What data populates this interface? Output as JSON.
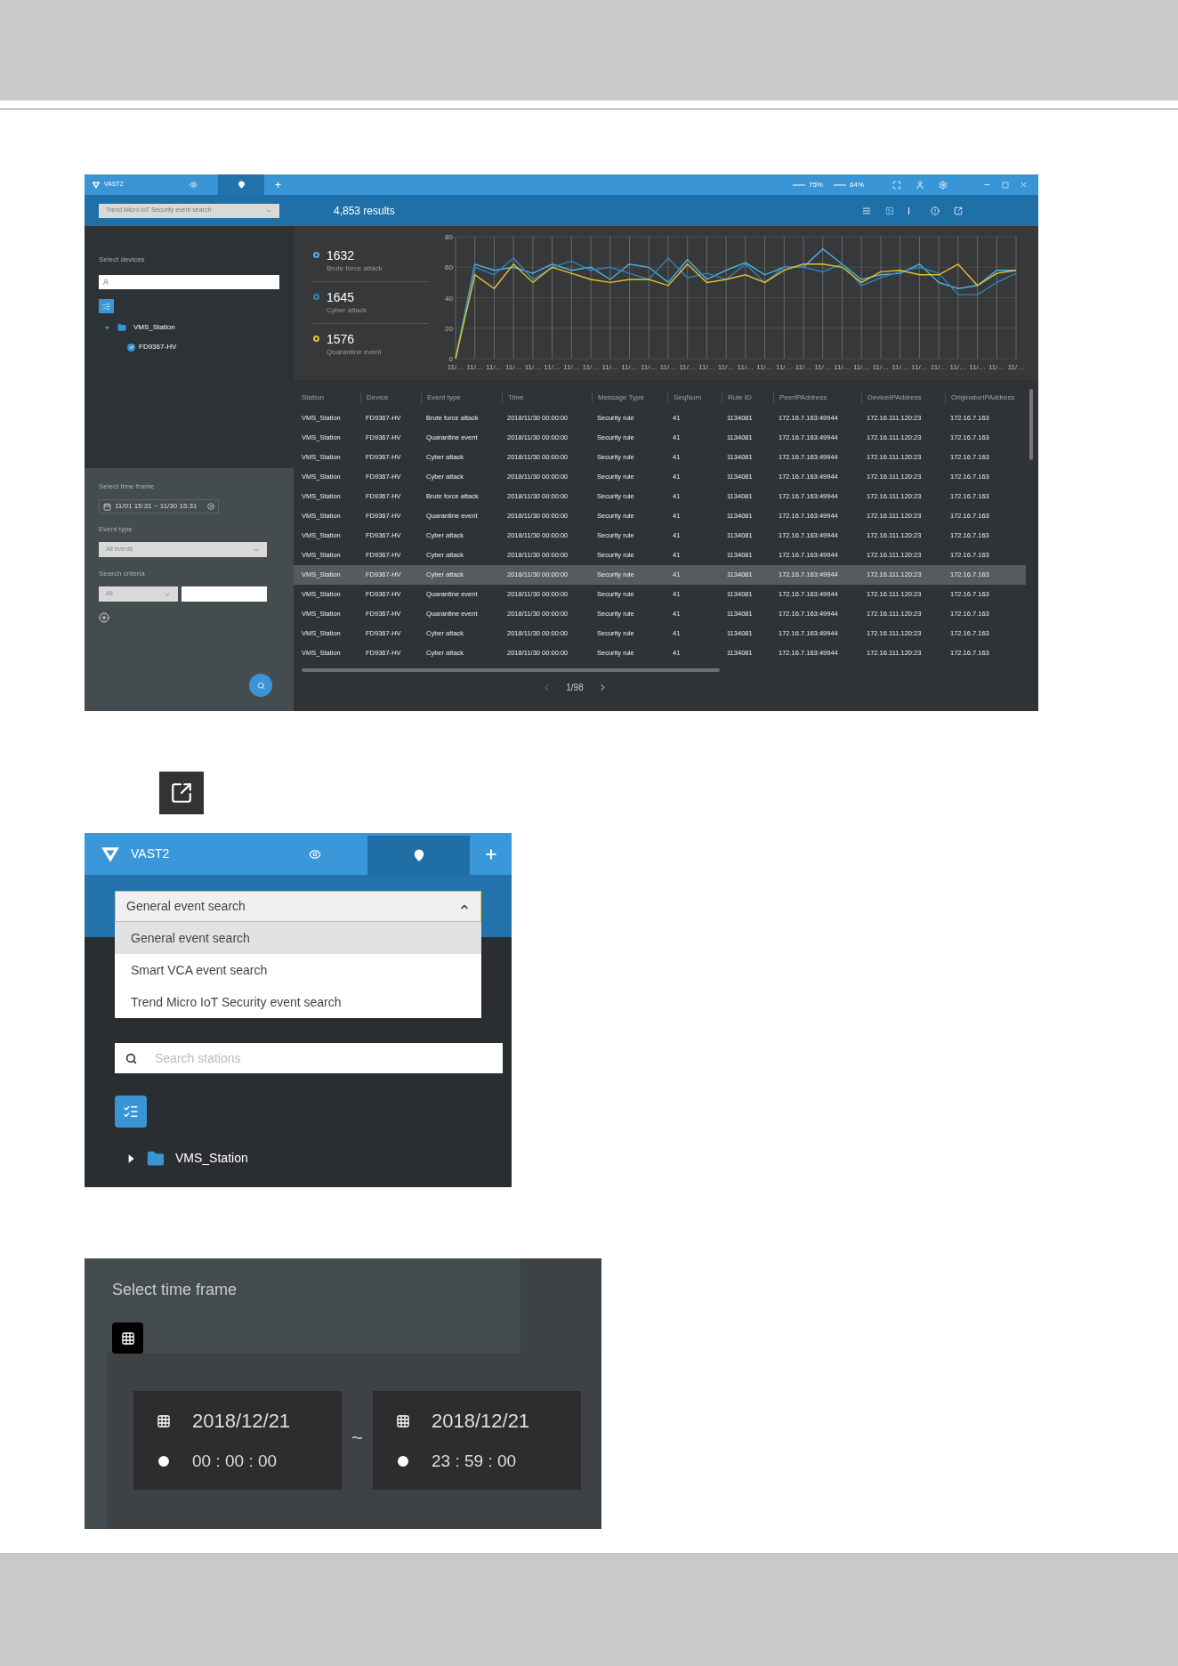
{
  "search_window": {
    "logo": "VAST2",
    "tabs": [
      {
        "kind": "live",
        "selected": false
      },
      {
        "kind": "search",
        "selected": true
      },
      {
        "kind": "add",
        "selected": false
      }
    ],
    "cpu": "75%",
    "ram": "64%",
    "search_mode": "Trend Micro IoT Security event search",
    "results": "4,853 results",
    "devices_label": "Select devices",
    "tree": [
      {
        "label": "VMS_Station",
        "expanded": true,
        "children": [
          {
            "label": "FD9367-HV",
            "checked": true
          }
        ]
      }
    ],
    "time_frame_label": "Select time frame",
    "time_frame": "11/01 15:31 ~ 11/30 15:31",
    "event_type_label": "Event type",
    "event_type": "All events",
    "criteria_label": "Search criteria",
    "criteria": "All",
    "stats": [
      {
        "count": "1632"
      },
      {
        "count": "1645"
      },
      {
        "count": "1576"
      }
    ],
    "chart_data": {
      "type": "line",
      "grid": true,
      "categories": [
        "11/…",
        "11/…",
        "11/…",
        "11/…",
        "11/…",
        "11/…",
        "11/…",
        "11/…",
        "11/…",
        "11/…",
        "11/…",
        "11/…",
        "11/…",
        "11/…",
        "11/…",
        "11/…",
        "11/…",
        "11/…",
        "11/…",
        "11/…",
        "11/…",
        "11/…",
        "11/…",
        "11/…",
        "11/…",
        "11/…",
        "11/…",
        "11/…",
        "11/…",
        "11/…"
      ],
      "ylim": [
        0,
        80
      ],
      "yticks": [
        0,
        20,
        40,
        60,
        80
      ],
      "series": [
        {
          "name": "Brute force attack",
          "color": "#4fb3e8",
          "values": [
            0,
            62,
            58,
            60,
            56,
            62,
            58,
            60,
            52,
            62,
            60,
            50,
            65,
            52,
            58,
            63,
            55,
            60,
            60,
            72,
            62,
            52,
            55,
            56,
            62,
            50,
            46,
            48,
            58,
            58
          ]
        },
        {
          "name": "Cyber attack",
          "color": "#2e86b8",
          "values": [
            0,
            60,
            55,
            66,
            52,
            60,
            64,
            58,
            60,
            56,
            52,
            66,
            53,
            56,
            52,
            62,
            50,
            60,
            60,
            57,
            62,
            48,
            53,
            57,
            60,
            56,
            42,
            42,
            50,
            56
          ]
        },
        {
          "name": "Quarantine event",
          "color": "#e6c12f",
          "values": [
            0,
            55,
            46,
            62,
            50,
            60,
            56,
            52,
            50,
            52,
            52,
            48,
            62,
            50,
            52,
            55,
            50,
            58,
            62,
            62,
            60,
            50,
            57,
            58,
            55,
            55,
            62,
            48,
            56,
            58
          ]
        }
      ]
    },
    "table": {
      "columns": [
        "Station",
        "Device",
        "Event type",
        "Time",
        "Message Type",
        "SeqNum",
        "Rule ID",
        "PeerIPAddress",
        "DeviceIPAddress",
        "OriginatorIPAddress"
      ],
      "rows": [
        {
          "selected": false,
          "cells": [
            "VMS_Station",
            "FD9367-HV",
            "Brute force attack",
            "2018/11/30 00:00:00",
            "Security rule",
            "41",
            "1134081",
            "172.16.7.163:49944",
            "172.16.111.120:23",
            "172.16.7.163"
          ]
        },
        {
          "selected": false,
          "cells": [
            "VMS_Station",
            "FD9367-HV",
            "Quarantine event",
            "2018/11/30 00:00:00",
            "Security rule",
            "41",
            "1134081",
            "172.16.7.163:49944",
            "172.16.111.120:23",
            "172.16.7.163"
          ]
        },
        {
          "selected": false,
          "cells": [
            "VMS_Station",
            "FD9367-HV",
            "Cyber attack",
            "2018/11/30 00:00:00",
            "Security rule",
            "41",
            "1134081",
            "172.16.7.163:49944",
            "172.16.111.120:23",
            "172.16.7.163"
          ]
        },
        {
          "selected": false,
          "cells": [
            "VMS_Station",
            "FD9367-HV",
            "Cyber attack",
            "2018/11/30 00:00:00",
            "Security rule",
            "41",
            "1134081",
            "172.16.7.163:49944",
            "172.16.111.120:23",
            "172.16.7.163"
          ]
        },
        {
          "selected": false,
          "cells": [
            "VMS_Station",
            "FD9367-HV",
            "Brute force attack",
            "2018/11/30 00:00:00",
            "Security rule",
            "41",
            "1134081",
            "172.16.7.163:49944",
            "172.16.111.120:23",
            "172.16.7.163"
          ]
        },
        {
          "selected": false,
          "cells": [
            "VMS_Station",
            "FD9367-HV",
            "Quarantine event",
            "2018/11/30 00:00:00",
            "Security rule",
            "41",
            "1134081",
            "172.16.7.163:49944",
            "172.16.111.120:23",
            "172.16.7.163"
          ]
        },
        {
          "selected": false,
          "cells": [
            "VMS_Station",
            "FD9367-HV",
            "Cyber attack",
            "2018/11/30 00:00:00",
            "Security rule",
            "41",
            "1134081",
            "172.16.7.163:49944",
            "172.16.111.120:23",
            "172.16.7.163"
          ]
        },
        {
          "selected": false,
          "cells": [
            "VMS_Station",
            "FD9367-HV",
            "Cyber attack",
            "2018/11/30 00:00:00",
            "Security rule",
            "41",
            "1134081",
            "172.16.7.163:49944",
            "172.16.111.120:23",
            "172.16.7.163"
          ]
        },
        {
          "selected": true,
          "cells": [
            "VMS_Station",
            "FD9367-HV",
            "Cyber attack",
            "2018/11/30 00:00:00",
            "Security rule",
            "41",
            "1134081",
            "172.16.7.163:49944",
            "172.16.111.120:23",
            "172.16.7.163"
          ]
        },
        {
          "selected": false,
          "cells": [
            "VMS_Station",
            "FD9367-HV",
            "Quarantine event",
            "2018/11/30 00:00:00",
            "Security rule",
            "41",
            "1134081",
            "172.16.7.163:49944",
            "172.16.111.120:23",
            "172.16.7.163"
          ]
        },
        {
          "selected": false,
          "cells": [
            "VMS_Station",
            "FD9367-HV",
            "Quarantine event",
            "2018/11/30 00:00:00",
            "Security rule",
            "41",
            "1134081",
            "172.16.7.163:49944",
            "172.16.111.120:23",
            "172.16.7.163"
          ]
        },
        {
          "selected": false,
          "cells": [
            "VMS_Station",
            "FD9367-HV",
            "Cyber attack",
            "2018/11/30 00:00:00",
            "Security rule",
            "41",
            "1134081",
            "172.16.7.163:49944",
            "172.16.111.120:23",
            "172.16.7.163"
          ]
        },
        {
          "selected": false,
          "cells": [
            "VMS_Station",
            "FD9367-HV",
            "Cyber attack",
            "2018/11/30 00:00:00",
            "Security rule",
            "41",
            "1134081",
            "172.16.7.163:49944",
            "172.16.111.120:23",
            "172.16.7.163"
          ]
        }
      ]
    },
    "pagination": "1/98"
  },
  "mode_menu_window": {
    "logo": "VAST2",
    "tabs": [
      {
        "kind": "live",
        "selected": false
      },
      {
        "kind": "search",
        "selected": true
      },
      {
        "kind": "add",
        "selected": false
      }
    ],
    "dropdown": {
      "value": "General event search",
      "expanded": true,
      "options": [
        {
          "label": "General event search",
          "selected": true
        },
        {
          "label": "Smart VCA event search",
          "selected": false
        },
        {
          "label": "Trend Micro IoT Security event search",
          "selected": false
        }
      ]
    },
    "search": {
      "placeholder": "Search stations"
    },
    "tree": [
      {
        "label": "VMS_Station",
        "expanded": false
      }
    ]
  },
  "time_frame_panel": {
    "title": "Select time frame",
    "separator": "~",
    "ranges": [
      {
        "date": "2018/12/21",
        "time": "00 : 00 : 00"
      },
      {
        "date": "2018/12/21",
        "time": "23 : 59 : 00"
      }
    ]
  }
}
